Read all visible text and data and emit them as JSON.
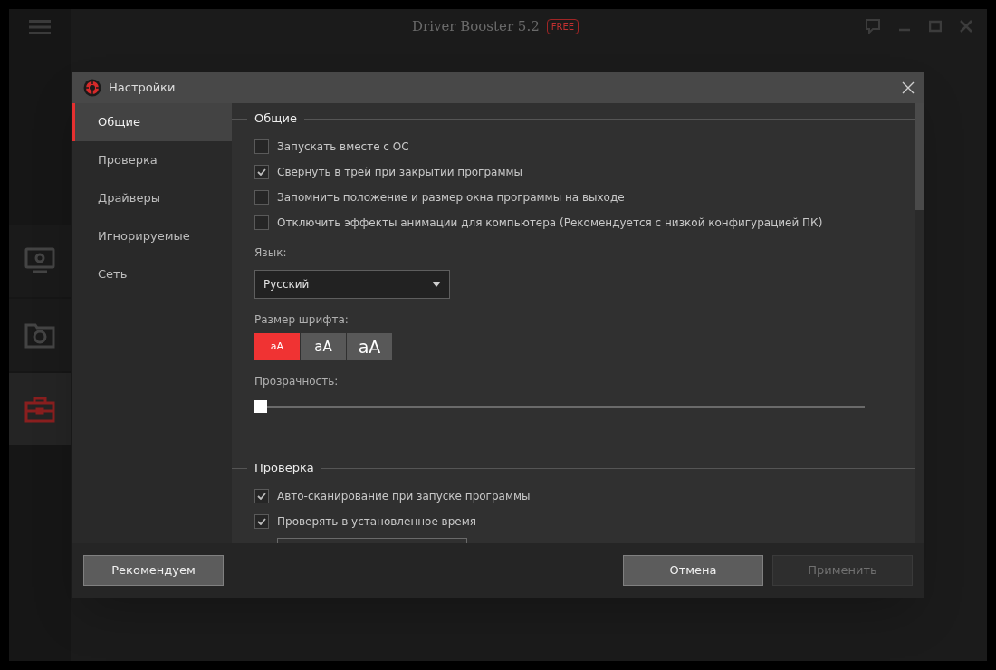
{
  "app": {
    "title": "Driver Booster 5.2",
    "badge": "FREE",
    "rail": [
      {
        "kind": "monitor",
        "selected": false
      },
      {
        "kind": "restore",
        "selected": false
      },
      {
        "kind": "toolbox",
        "selected": true
      }
    ]
  },
  "dialog": {
    "title": "Настройки",
    "nav": [
      {
        "label": "Общие",
        "selected": true
      },
      {
        "label": "Проверка",
        "selected": false
      },
      {
        "label": "Драйверы",
        "selected": false
      },
      {
        "label": "Игнорируемые",
        "selected": false
      },
      {
        "label": "Сеть",
        "selected": false
      }
    ],
    "sections": [
      {
        "title": "Общие",
        "options": [
          {
            "label": "Запускать вместе с ОС",
            "checked": false
          },
          {
            "label": "Свернуть в трей при закрытии программы",
            "checked": true
          },
          {
            "label": "Запомнить положение и размер окна программы на выходе",
            "checked": false
          },
          {
            "label": "Отключить эффекты анимации для компьютера (Рекомендуется с низкой конфигурацией ПК)",
            "checked": false
          }
        ],
        "language": {
          "label": "Язык:",
          "value": "Русский"
        },
        "font_size": {
          "label": "Размер шрифта:",
          "options": [
            {
              "label": "aA",
              "selected": true
            },
            {
              "label": "aA",
              "selected": false
            },
            {
              "label": "aA",
              "selected": false
            }
          ]
        },
        "transparency": {
          "label": "Прозрачность:",
          "level": 0
        }
      },
      {
        "title": "Проверка",
        "options": [
          {
            "label": "Авто-сканирование при запуске программы",
            "checked": true
          },
          {
            "label": "Проверять в установленное время",
            "checked": true
          }
        ]
      }
    ],
    "buttons": [
      {
        "label": "Рекомендуем",
        "disabled": false
      },
      {
        "label": "Отмена",
        "disabled": false
      },
      {
        "label": "Применить",
        "disabled": true
      }
    ]
  }
}
